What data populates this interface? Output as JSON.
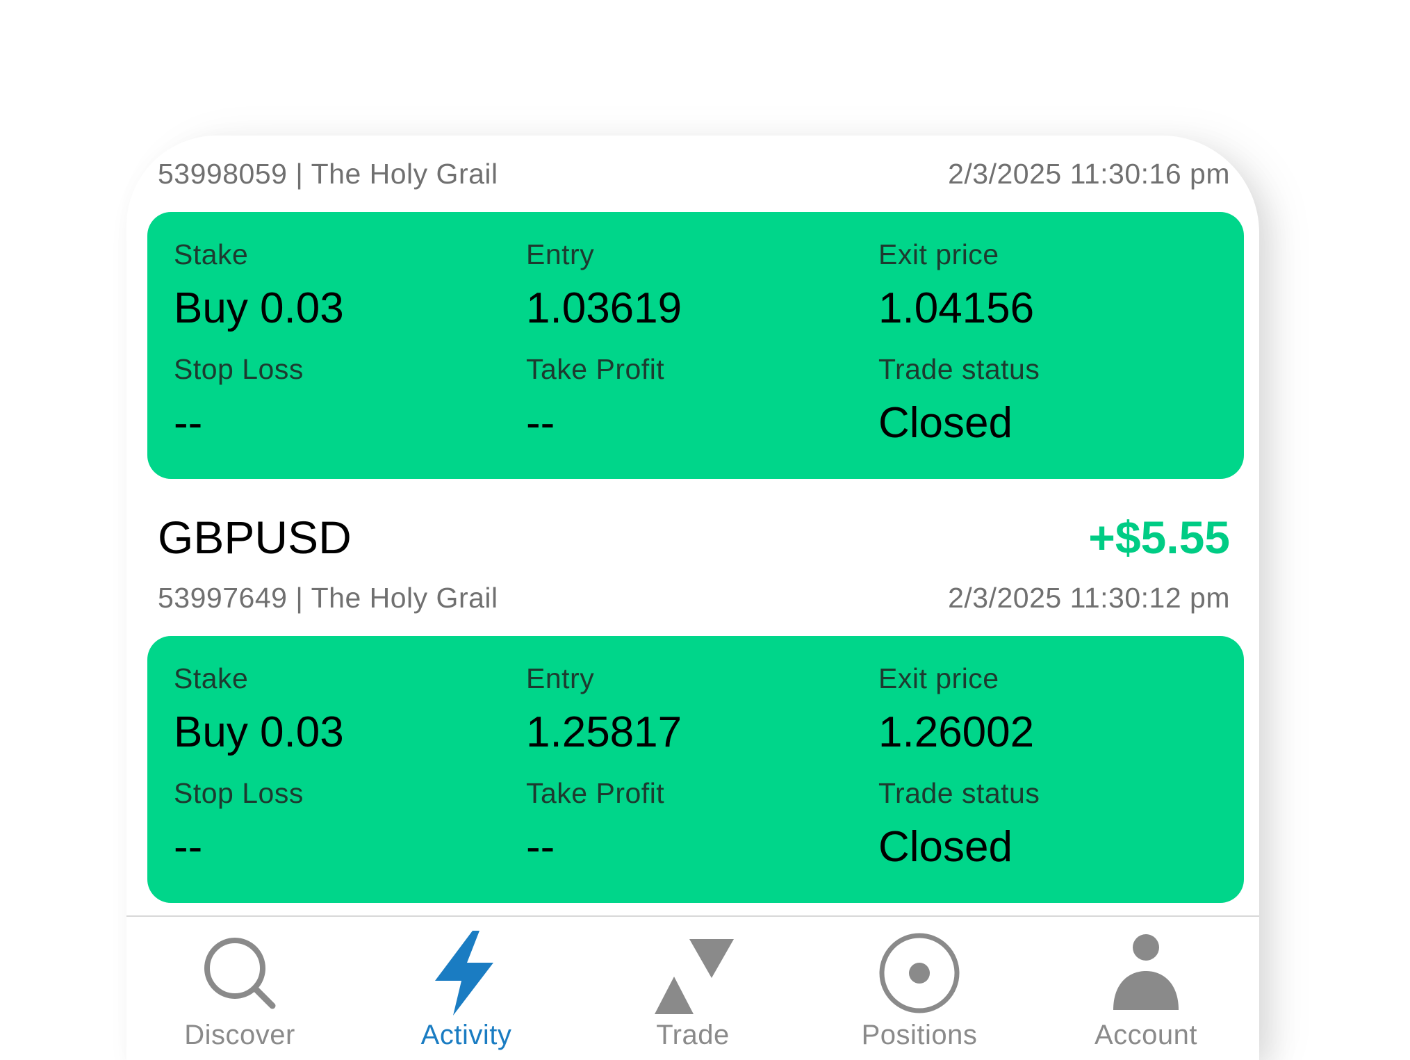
{
  "colors": {
    "card_green": "#00d68a",
    "profit_green": "#00cc84",
    "active_tab": "#1a7cc2",
    "inactive_tab": "#8a8a8a"
  },
  "trades": [
    {
      "id_line": "53998059 | The Holy Grail",
      "timestamp": "2/3/2025 11:30:16 pm",
      "fields": {
        "stake_label": "Stake",
        "stake_value": "Buy 0.03",
        "entry_label": "Entry",
        "entry_value": "1.03619",
        "exit_label": "Exit price",
        "exit_value": "1.04156",
        "sl_label": "Stop Loss",
        "sl_value": "--",
        "tp_label": "Take Profit",
        "tp_value": "--",
        "status_label": "Trade status",
        "status_value": "Closed"
      }
    },
    {
      "symbol": "GBPUSD",
      "pnl": "+$5.55",
      "id_line": "53997649 | The Holy Grail",
      "timestamp": "2/3/2025 11:30:12 pm",
      "fields": {
        "stake_label": "Stake",
        "stake_value": "Buy 0.03",
        "entry_label": "Entry",
        "entry_value": "1.25817",
        "exit_label": "Exit price",
        "exit_value": "1.26002",
        "sl_label": "Stop Loss",
        "sl_value": "--",
        "tp_label": "Take Profit",
        "tp_value": "--",
        "status_label": "Trade status",
        "status_value": "Closed"
      }
    }
  ],
  "tabs": [
    {
      "label": "Discover",
      "icon": "search-icon"
    },
    {
      "label": "Activity",
      "icon": "lightning-icon",
      "active": true
    },
    {
      "label": "Trade",
      "icon": "trade-arrows-icon"
    },
    {
      "label": "Positions",
      "icon": "target-icon"
    },
    {
      "label": "Account",
      "icon": "person-icon"
    }
  ]
}
